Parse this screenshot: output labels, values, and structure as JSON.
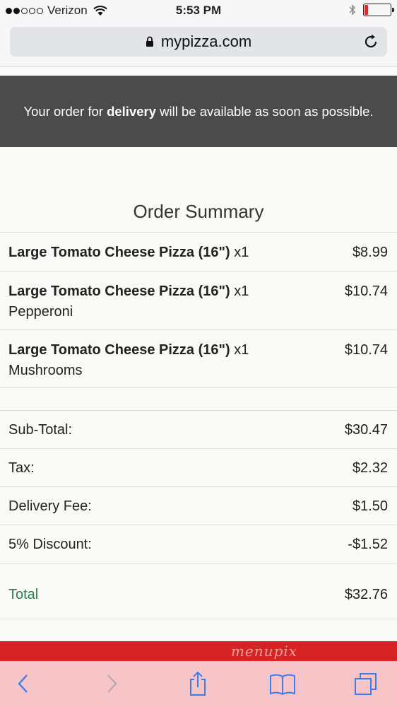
{
  "status_bar": {
    "carrier": "Verizon",
    "time": "5:53 PM",
    "signal_bars_filled": 2,
    "signal_bars_total": 5,
    "battery_level": 0.12
  },
  "browser": {
    "url": "mypizza.com",
    "lock_icon": "lock-icon",
    "reload_icon": "reload-icon"
  },
  "banner": {
    "prefix": "Your order for ",
    "mode": "delivery",
    "suffix": " will be available as soon as possible."
  },
  "summary": {
    "title": "Order Summary",
    "items": [
      {
        "name": "Large Tomato Cheese Pizza (16\")",
        "qty": "x1",
        "detail": "",
        "price": "$8.99"
      },
      {
        "name": "Large Tomato Cheese Pizza (16\")",
        "qty": "x1",
        "detail": "Pepperoni",
        "price": "$10.74"
      },
      {
        "name": "Large Tomato Cheese Pizza (16\")",
        "qty": "x1",
        "detail": "Mushrooms",
        "price": "$10.74"
      }
    ],
    "totals": [
      {
        "label": "Sub-Total:",
        "value": "$30.47"
      },
      {
        "label": "Tax:",
        "value": "$2.32"
      },
      {
        "label": "Delivery Fee:",
        "value": "$1.50"
      },
      {
        "label": "5% Discount:",
        "value": "-$1.52"
      }
    ],
    "total": {
      "label": "Total",
      "value": "$32.76"
    }
  },
  "watermark": "menupix",
  "colors": {
    "banner_bg": "#4b4b4b",
    "total_label": "#2e7d4f",
    "red_bar": "#d62424",
    "toolbar_tint": "#f7c4c8",
    "toolbar_icon": "#3b7cf0"
  },
  "toolbar": {
    "icons": [
      "back-icon",
      "forward-icon",
      "share-icon",
      "bookmarks-icon",
      "tabs-icon"
    ]
  }
}
